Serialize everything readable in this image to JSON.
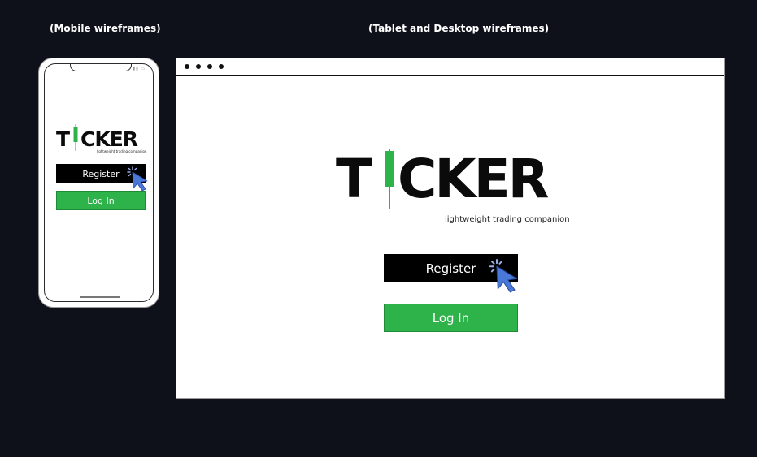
{
  "captions": {
    "mobile": "(Mobile wireframes)",
    "desktop": "(Tablet and Desktop wireframes)"
  },
  "logo": {
    "first_letter": "T",
    "rest": "CKER",
    "tagline": "lightweight trading companion",
    "candle_color": "#2db34a",
    "icon": "candlestick-icon"
  },
  "buttons": {
    "register_label": "Register",
    "login_label": "Log In"
  },
  "icons": {
    "cursor": "pointer-cursor-click-icon",
    "signal": "signal-icon",
    "battery": "battery-icon"
  },
  "colors": {
    "background": "#0e111a",
    "accent_green": "#2db34a",
    "cursor_blue": "#4a78d8"
  }
}
